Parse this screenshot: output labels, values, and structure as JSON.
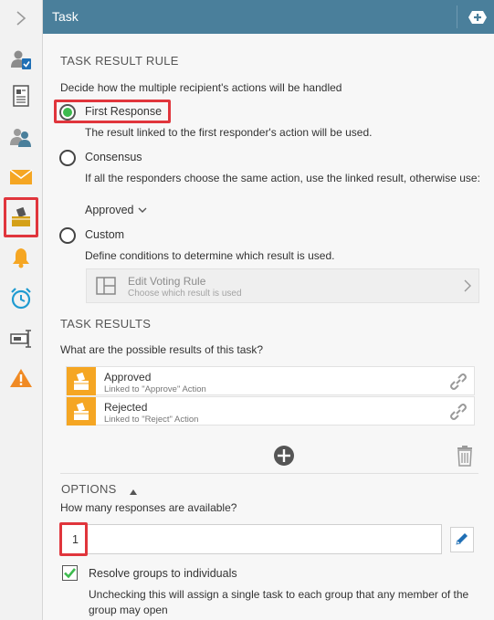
{
  "header": {
    "title": "Task",
    "add_icon": "plus-icon"
  },
  "sidebar": {
    "items": [
      {
        "name": "expand",
        "icon": "chevron-right-icon"
      },
      {
        "name": "assign",
        "icon": "user-check-icon"
      },
      {
        "name": "form",
        "icon": "document-icon"
      },
      {
        "name": "participants",
        "icon": "users-icon"
      },
      {
        "name": "email",
        "icon": "envelope-icon"
      },
      {
        "name": "actions",
        "icon": "ballot-box-icon"
      },
      {
        "name": "notifications",
        "icon": "bell-icon"
      },
      {
        "name": "deadline",
        "icon": "alarm-clock-icon"
      },
      {
        "name": "references",
        "icon": "text-field-icon"
      },
      {
        "name": "warnings",
        "icon": "warning-icon"
      }
    ]
  },
  "result_rule": {
    "section_title": "TASK RESULT RULE",
    "description": "Decide how the multiple recipient's actions will be handled",
    "options": [
      {
        "label": "First Response",
        "checked": true,
        "description": "The result linked to the first responder's action will be used."
      },
      {
        "label": "Consensus",
        "checked": false,
        "description": "If all the responders choose the same action, use the linked result, otherwise use:"
      },
      {
        "label": "Custom",
        "checked": false,
        "description": "Define conditions to determine which result is used."
      }
    ],
    "consensus_fallback": "Approved",
    "voting_rule": {
      "title": "Edit Voting Rule",
      "subtitle": "Choose which result is used"
    }
  },
  "task_results": {
    "section_title": "TASK RESULTS",
    "description": "What are the possible results of this task?",
    "items": [
      {
        "title": "Approved",
        "subtitle": "Linked to \"Approve\" Action"
      },
      {
        "title": "Rejected",
        "subtitle": "Linked to \"Reject\" Action"
      }
    ]
  },
  "options": {
    "section_title": "OPTIONS",
    "responses_question": "How many responses are available?",
    "responses_value": "1",
    "resolve_groups_label": "Resolve groups to individuals",
    "resolve_groups_checked": true,
    "resolve_groups_description": "Unchecking this will assign a single task to each group that any member of the group may open"
  },
  "colors": {
    "header": "#4a7f9b",
    "highlight": "#e0353c",
    "radio_checked": "#3dbb4e",
    "result_icon": "#f5a623",
    "edit_icon": "#1f6fb5"
  }
}
